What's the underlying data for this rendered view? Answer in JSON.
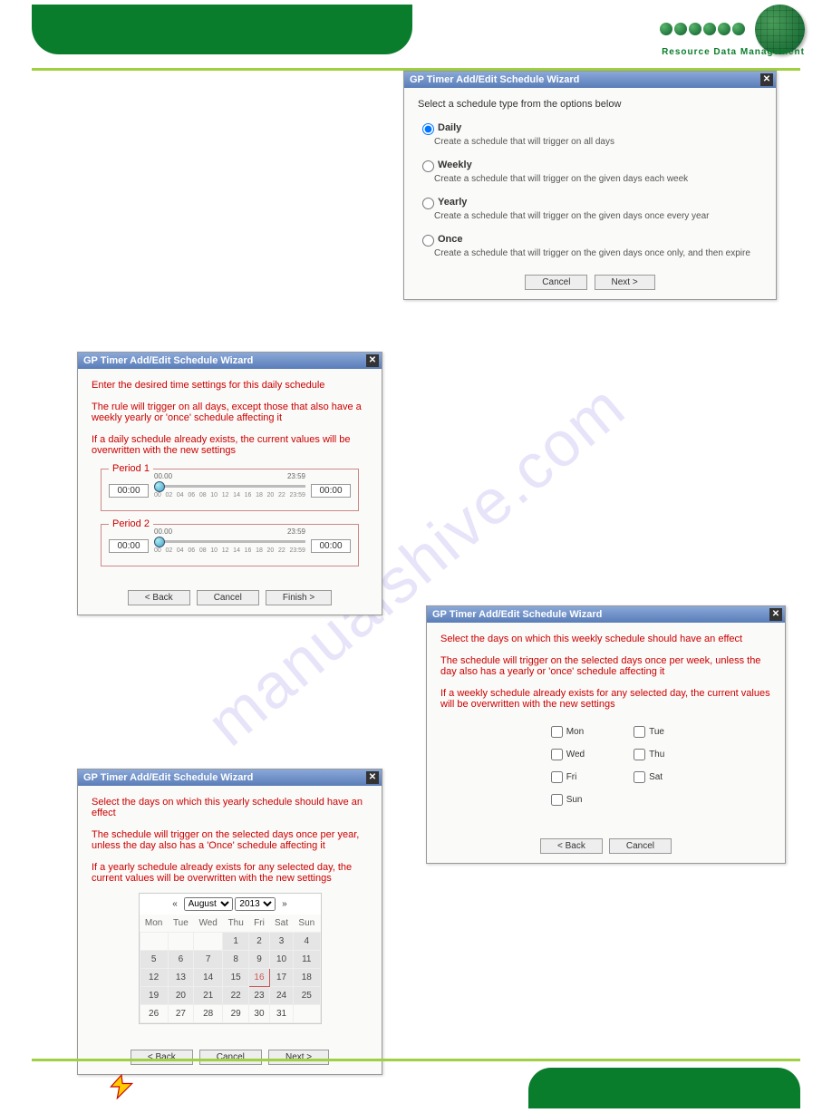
{
  "brand": "Resource Data Management",
  "watermark": "manualshive.com",
  "wizard_title": "GP Timer Add/Edit Schedule Wizard",
  "close_glyph": "✕",
  "buttons": {
    "back": "< Back",
    "cancel": "Cancel",
    "next": "Next >",
    "finish": "Finish >"
  },
  "dlg1": {
    "intro": "Select a schedule type from the options below",
    "options": [
      {
        "label": "Daily",
        "desc": "Create a schedule that will trigger on all days",
        "checked": true
      },
      {
        "label": "Weekly",
        "desc": "Create a schedule that will trigger on the given days each week",
        "checked": false
      },
      {
        "label": "Yearly",
        "desc": "Create a schedule that will trigger on the given days once every year",
        "checked": false
      },
      {
        "label": "Once",
        "desc": "Create a schedule that will trigger on the given days once only, and then expire",
        "checked": false
      }
    ]
  },
  "dlg2": {
    "line1": "Enter the desired time settings for this daily schedule",
    "line2": "The rule will trigger on all days, except those that also have a weekly yearly or 'once' schedule affecting it",
    "line3": "If a daily schedule already exists, the current values will be overwritten with the new settings",
    "period1_label": "Period 1",
    "period2_label": "Period 2",
    "start": "00:00",
    "mid": "00.00",
    "end_label": "23:59",
    "end": "00:00",
    "ticks": [
      "00",
      "02",
      "04",
      "06",
      "08",
      "10",
      "12",
      "14",
      "16",
      "18",
      "20",
      "22",
      "23:59"
    ]
  },
  "dlg3": {
    "line1": "Select the days on which this weekly schedule should have an effect",
    "line2": "The schedule will trigger on the selected days once per week, unless the day also has a yearly or 'once' schedule affecting it",
    "line3": "If a weekly schedule already exists for any selected day, the current values will be overwritten with the new settings",
    "days_left": [
      "Mon",
      "Wed",
      "Fri",
      "Sun"
    ],
    "days_right": [
      "Tue",
      "Thu",
      "Sat"
    ]
  },
  "dlg4": {
    "line1": "Select the days on which this yearly schedule should have an effect",
    "line2": "The schedule will trigger on the selected days once per year, unless the day also has a 'Once' schedule affecting it",
    "line3": "If a yearly schedule already exists for any selected day, the current values will be overwritten with the new settings",
    "month": "August",
    "year": "2013",
    "dow": [
      "Mon",
      "Tue",
      "Wed",
      "Thu",
      "Fri",
      "Sat",
      "Sun"
    ],
    "weeks": [
      [
        "",
        "",
        "",
        "1",
        "2",
        "3",
        "4"
      ],
      [
        "5",
        "6",
        "7",
        "8",
        "9",
        "10",
        "11"
      ],
      [
        "12",
        "13",
        "14",
        "15",
        "16",
        "17",
        "18"
      ],
      [
        "19",
        "20",
        "21",
        "22",
        "23",
        "24",
        "25"
      ],
      [
        "26",
        "27",
        "28",
        "29",
        "30",
        "31",
        ""
      ]
    ],
    "highlight": "16"
  }
}
